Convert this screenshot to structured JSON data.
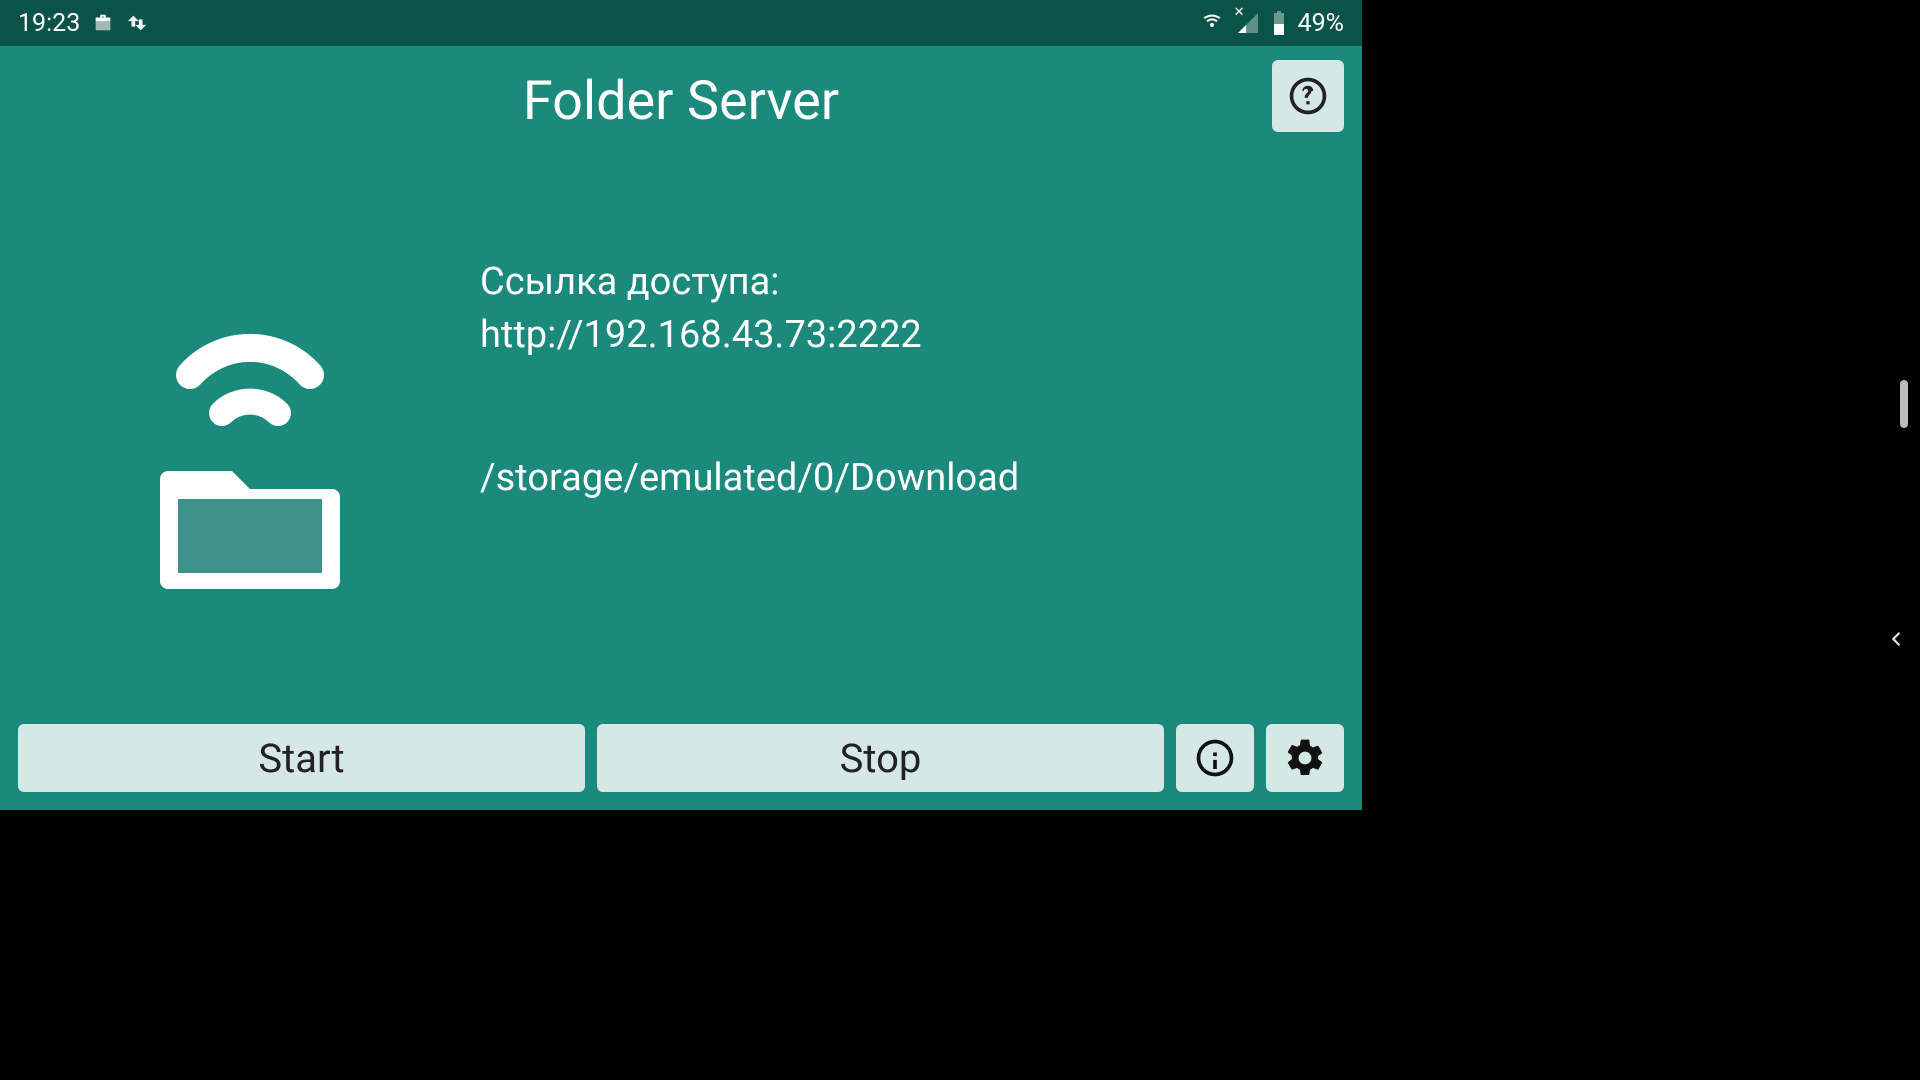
{
  "statusbar": {
    "time": "19:23",
    "battery": "49%"
  },
  "header": {
    "title": "Folder Server"
  },
  "main": {
    "access_label": "Ссылка доступа:",
    "access_url": "http://192.168.43.73:2222",
    "folder_path": "/storage/emulated/0/Download"
  },
  "buttons": {
    "start": "Start",
    "stop": "Stop"
  }
}
